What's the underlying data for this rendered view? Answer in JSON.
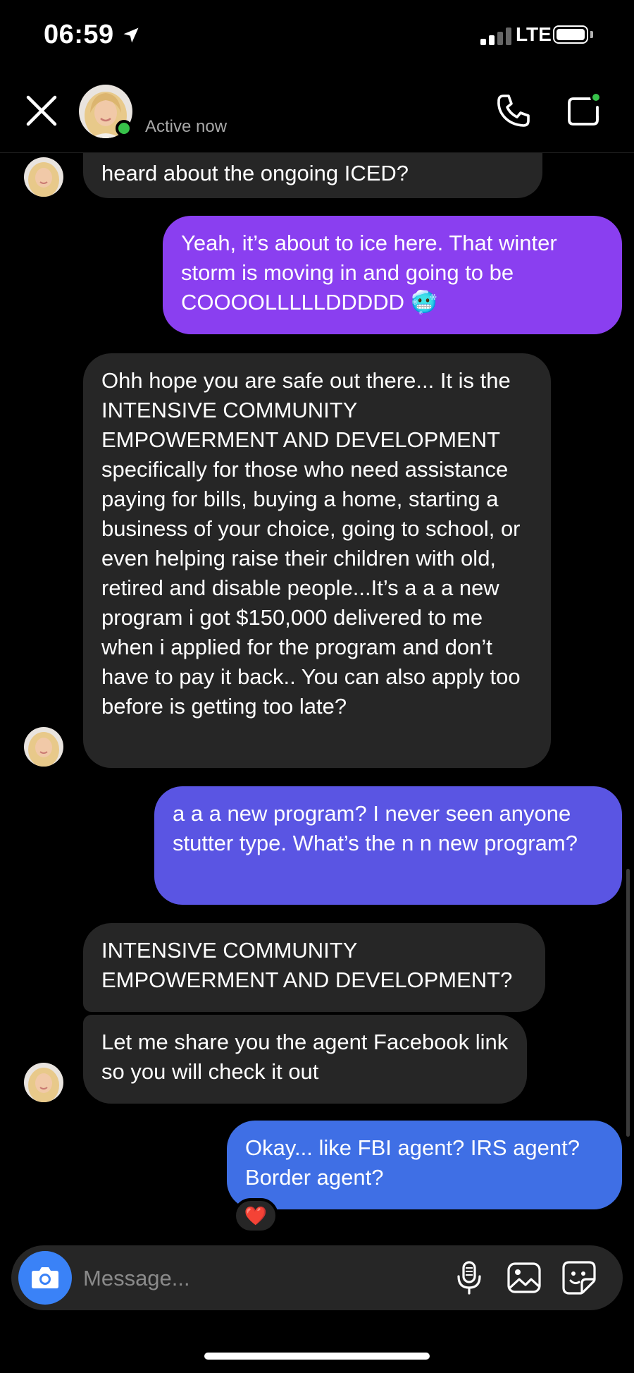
{
  "status_bar": {
    "time": "06:59",
    "network": "LTE",
    "icons": [
      "location-arrow-icon",
      "signal-icon",
      "battery-icon"
    ]
  },
  "header": {
    "status": "Active now",
    "icons": [
      "close-icon",
      "phone-icon",
      "video-call-icon"
    ],
    "accent_online": "#37c24a"
  },
  "conversation": {
    "messages": [
      {
        "sender": "them",
        "text": "heard about the ongoing ICED?"
      },
      {
        "sender": "me",
        "text": "Yeah, it’s about to ice here. That winter storm is moving in and going to be COOOOLLLLLDDDDD 🥶"
      },
      {
        "sender": "them",
        "text": "Ohh hope you are safe out there... It is the INTENSIVE COMMUNITY EMPOWERMENT AND DEVELOPMENT specifically for those who need assistance paying for bills, buying a home, starting a business of your choice, going to school, or even helping raise their children with old, retired and disable people...It’s a a a new program i got $150,000 delivered to me when i applied for the program and don’t have to pay it back.. You can also apply too before is getting too late?"
      },
      {
        "sender": "me",
        "text": "a a a new program? I never seen anyone stutter type. What’s the n n new program?"
      },
      {
        "sender": "them",
        "text": "INTENSIVE COMMUNITY EMPOWERMENT AND DEVELOPMENT?"
      },
      {
        "sender": "them",
        "text": "Let me share you the agent Facebook link so you will check it out"
      },
      {
        "sender": "me",
        "text": "Okay... like FBI agent? IRS agent? Border agent?",
        "reaction": "❤️"
      }
    ],
    "colors": {
      "incoming_bubble": "#262626",
      "outgoing_gradient_top": "#8a3ff0",
      "outgoing_gradient_mid": "#5a55e3",
      "outgoing_gradient_bottom": "#3f6fe5"
    }
  },
  "composer": {
    "placeholder": "Message...",
    "icons": [
      "camera-icon",
      "microphone-icon",
      "gallery-icon",
      "sticker-icon"
    ],
    "camera_color": "#3a82f7"
  }
}
